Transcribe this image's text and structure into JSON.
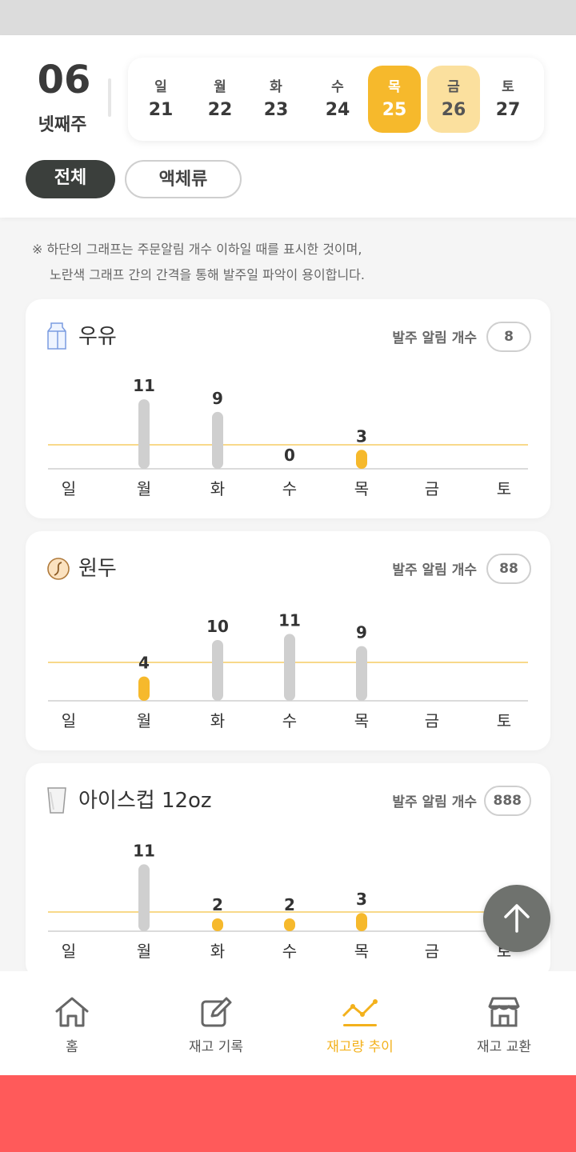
{
  "header": {
    "week_number": "06",
    "week_label": "넷째주",
    "days": [
      {
        "name": "일",
        "date": "21",
        "state": "normal"
      },
      {
        "name": "월",
        "date": "22",
        "state": "normal"
      },
      {
        "name": "화",
        "date": "23",
        "state": "normal"
      },
      {
        "name": "수",
        "date": "24",
        "state": "normal"
      },
      {
        "name": "목",
        "date": "25",
        "state": "today"
      },
      {
        "name": "금",
        "date": "26",
        "state": "next"
      },
      {
        "name": "토",
        "date": "27",
        "state": "normal"
      }
    ],
    "filters": [
      {
        "label": "전체",
        "active": true
      },
      {
        "label": "액체류",
        "active": false
      }
    ]
  },
  "notice": {
    "line1": "※ 하단의 그래프는 주문알림 개수 이하일 때를 표시한 것이며,",
    "line2": "노란색 그래프 간의 간격을 통해 발주일 파악이 용이합니다."
  },
  "cards": [
    {
      "title": "우유",
      "icon": "milk-carton-icon",
      "alert_label": "발주 알림 개수",
      "alert_count": "8",
      "chart_data": {
        "type": "bar",
        "categories": [
          "일",
          "월",
          "화",
          "수",
          "목",
          "금",
          "토"
        ],
        "values": [
          null,
          11,
          9,
          0,
          3,
          null,
          null
        ],
        "highlighted": [
          false,
          false,
          false,
          false,
          true,
          false,
          false
        ],
        "threshold": 8
      }
    },
    {
      "title": "원두",
      "icon": "coffee-bean-icon",
      "alert_label": "발주 알림 개수",
      "alert_count": "88",
      "chart_data": {
        "type": "bar",
        "categories": [
          "일",
          "월",
          "화",
          "수",
          "목",
          "금",
          "토"
        ],
        "values": [
          null,
          4,
          10,
          11,
          9,
          null,
          null
        ],
        "highlighted": [
          false,
          true,
          false,
          false,
          false,
          false,
          false
        ],
        "threshold": 88
      }
    },
    {
      "title": "아이스컵 12oz",
      "icon": "cup-icon",
      "alert_label": "발주 알림 개수",
      "alert_count": "888",
      "chart_data": {
        "type": "bar",
        "categories": [
          "일",
          "월",
          "화",
          "수",
          "목",
          "금",
          "토"
        ],
        "values": [
          null,
          11,
          2,
          2,
          3,
          null,
          null
        ],
        "highlighted": [
          false,
          false,
          true,
          true,
          true,
          false,
          false
        ],
        "threshold": 888
      }
    }
  ],
  "nav": [
    {
      "label": "홈",
      "icon": "home-icon",
      "active": false
    },
    {
      "label": "재고 기록",
      "icon": "edit-icon",
      "active": false
    },
    {
      "label": "재고량 추이",
      "icon": "trend-icon",
      "active": true
    },
    {
      "label": "재고 교환",
      "icon": "store-icon",
      "active": false
    }
  ],
  "colors": {
    "accent": "#f6b92c",
    "accent_light": "#fbe09e",
    "bar_gray": "#cfcfcf",
    "threshold_line": "#f8d98a",
    "dark": "#3b3f3c",
    "footer": "#ff5a5a"
  }
}
